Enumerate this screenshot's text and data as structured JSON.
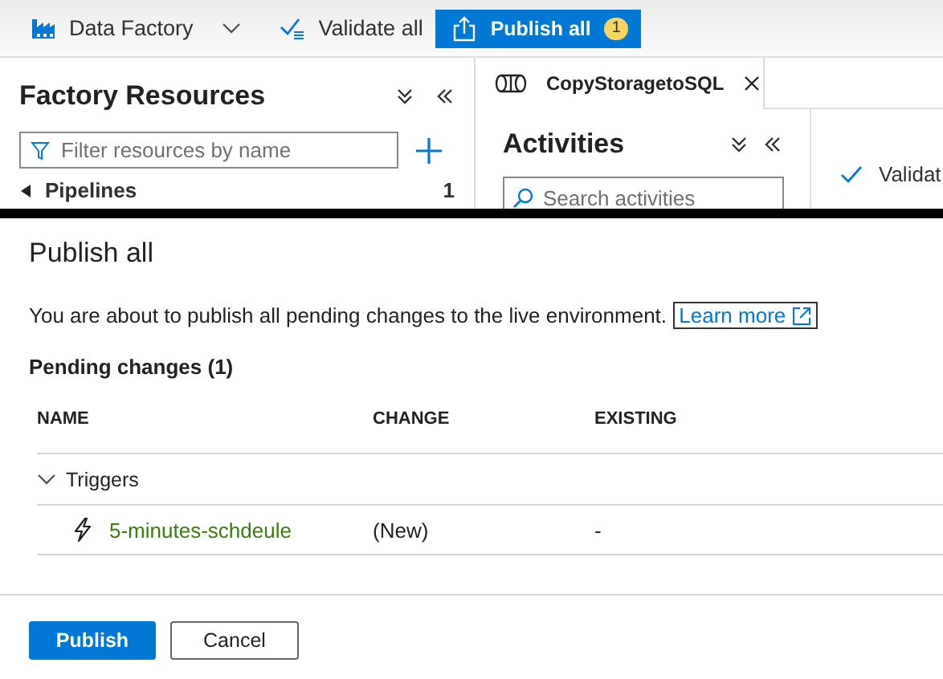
{
  "toolbar": {
    "factory_name": "Data Factory",
    "validate_label": "Validate all",
    "publish_label": "Publish all",
    "publish_badge": "1"
  },
  "resources": {
    "title": "Factory Resources",
    "filter": {
      "placeholder": "Filter resources by name"
    },
    "items": [
      {
        "label": "Pipelines",
        "count": "1"
      }
    ]
  },
  "editor": {
    "tabs": [
      {
        "label": "CopyStoragetoSQL",
        "selected": true
      }
    ],
    "activities": {
      "title": "Activities",
      "search": {
        "placeholder": "Search activities"
      }
    },
    "validate_label": "Validat"
  },
  "dialog": {
    "title": "Publish all",
    "message": "You are about to publish all pending changes to the live environment.",
    "link": "Learn more",
    "pending_title": "Pending changes (1)",
    "columns": [
      "NAME",
      "CHANGE",
      "EXISTING"
    ],
    "groups": [
      {
        "name": "Triggers",
        "expanded": true,
        "items": [
          {
            "name": "5-minutes-schdeule",
            "change": "(New)",
            "existing": "-"
          }
        ]
      }
    ],
    "buttons": [
      {
        "label": "Publish",
        "kind": "primary"
      },
      {
        "label": "Cancel",
        "kind": "default"
      }
    ]
  }
}
